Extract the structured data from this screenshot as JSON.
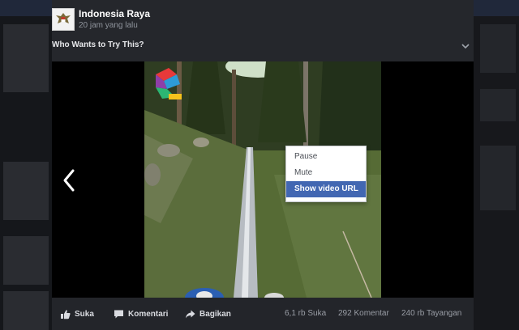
{
  "post": {
    "page_name": "Indonesia Raya",
    "time": "20 jam yang lalu",
    "caption": "Who Wants to Try This?"
  },
  "video_context_menu": {
    "items": [
      {
        "label": "Pause"
      },
      {
        "label": "Mute"
      },
      {
        "label": "Show video URL"
      }
    ],
    "highlighted_index": 2
  },
  "actions": {
    "like_label": "Suka",
    "comment_label": "Komentari",
    "share_label": "Bagikan"
  },
  "stats": {
    "likes": "6,1 rb Suka",
    "comments": "292 Komentar",
    "views": "240 rb Tayangan"
  },
  "colors": {
    "accent": "#4267b2",
    "background": "#1f2126",
    "video_letterbox": "#000000"
  },
  "icons": {
    "like": "thumbs-up-icon",
    "comment": "speech-bubble-icon",
    "share": "share-arrow-icon",
    "previous": "chevron-left-icon",
    "options": "chevron-down-icon"
  }
}
